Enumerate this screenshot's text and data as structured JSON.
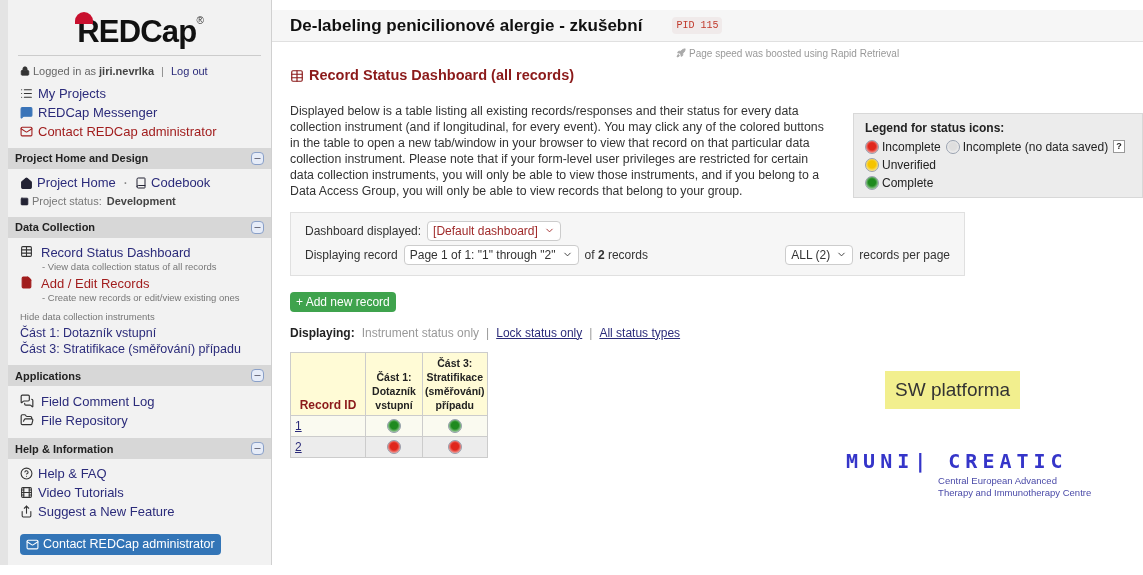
{
  "sidebar": {
    "logo": {
      "name": "REDCap",
      "mark": "®"
    },
    "login": {
      "prefix": "Logged in as",
      "user": "jiri.nevrlka",
      "separator": "|",
      "logout": "Log out"
    },
    "top_links": [
      {
        "label": "My Projects",
        "kind": "normal"
      },
      {
        "label": "REDCap Messenger",
        "kind": "normal"
      },
      {
        "label": "Contact REDCap administrator",
        "kind": "alert"
      }
    ],
    "sections": [
      {
        "title": "Project Home and Design",
        "expanded": true,
        "links": [
          {
            "label": "Project Home",
            "kind": "normal"
          },
          {
            "label": "Codebook",
            "kind": "normal"
          }
        ],
        "link_separator": "·",
        "status_label": "Project status:",
        "status_value": "Development"
      },
      {
        "title": "Data Collection",
        "expanded": true,
        "links": [
          {
            "label": "Record Status Dashboard",
            "kind": "normal",
            "note": "- View data collection status of all records"
          },
          {
            "label": "Add / Edit Records",
            "kind": "alert",
            "note": "- Create new records or edit/view existing ones"
          }
        ],
        "toggle": "Hide data collection instruments",
        "instruments": [
          "Část 1: Dotazník vstupní",
          "Část 3: Stratifikace (směřování) případu"
        ]
      },
      {
        "title": "Applications",
        "expanded": true,
        "links": [
          {
            "label": "Field Comment Log",
            "kind": "normal"
          },
          {
            "label": "File Repository",
            "kind": "normal"
          }
        ]
      },
      {
        "title": "Help & Information",
        "expanded": true,
        "links": [
          {
            "label": "Help & FAQ",
            "kind": "normal"
          },
          {
            "label": "Video Tutorials",
            "kind": "normal"
          },
          {
            "label": "Suggest a New Feature",
            "kind": "normal"
          }
        ],
        "button": "Contact REDCap administrator"
      }
    ]
  },
  "header": {
    "title": "De-labeling penicilionové alergie - zkušební",
    "pid": "PID 115"
  },
  "speed_note": "Page speed was boosted using Rapid Retrieval",
  "page_title": "Record Status Dashboard (all records)",
  "description": "Displayed below is a table listing all existing records/responses and their status for every data collection instrument (and if longitudinal, for every event). You may click any of the colored buttons in the table to open a new tab/window in your browser to view that record on that particular data collection instrument. Please note that if your form-level user privileges are restricted for certain data collection instruments, you will only be able to view those instruments, and if you belong to a Data Access Group, you will only be able to view records that belong to your group.",
  "legend": {
    "title": "Legend for status icons:",
    "items": [
      {
        "kind": "incomplete",
        "label": "Incomplete"
      },
      {
        "kind": "empty",
        "label": "Incomplete (no data saved)",
        "help": "?"
      },
      {
        "kind": "unverified",
        "label": "Unverified"
      },
      {
        "kind": "complete",
        "label": "Complete"
      }
    ]
  },
  "controls": {
    "dashboard_label": "Dashboard displayed:",
    "dashboard_value": "[Default dashboard]",
    "record_label": "Displaying record",
    "record_value": "Page 1 of 1: \"1\" through \"2\"",
    "count_prefix": "of",
    "count": "2",
    "count_suffix": "records",
    "per_page_value": "ALL (2)",
    "per_page_label": "records per page"
  },
  "add_button": "+ Add new record",
  "displaying": {
    "label": "Displaying:",
    "separator": "|",
    "options": [
      {
        "label": "Instrument status only",
        "selected": true
      },
      {
        "label": "Lock status only",
        "selected": false
      },
      {
        "label": "All status types",
        "selected": false
      }
    ]
  },
  "table": {
    "columns": [
      "Record ID",
      "Část 1: Dotazník vstupní",
      "Část 3: Stratifikace (směřování) případu"
    ],
    "rows": [
      {
        "id": "1",
        "statuses": [
          {
            "kind": "complete"
          },
          {
            "kind": "complete"
          }
        ]
      },
      {
        "id": "2",
        "statuses": [
          {
            "kind": "incomplete"
          },
          {
            "kind": "incomplete"
          }
        ]
      }
    ]
  },
  "note": "SW platforma",
  "partner_logo": {
    "name": "MUNI| CREATIC",
    "subtitle_1": "Central European Advanced",
    "subtitle_2": "Therapy and Immunotherapy Centre"
  }
}
